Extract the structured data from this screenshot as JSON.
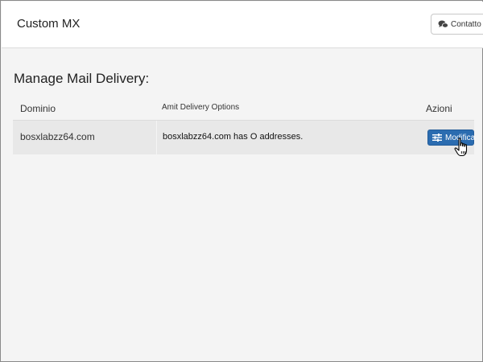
{
  "header": {
    "app_title": "Custom MX",
    "contact_label": "Contatto",
    "contact_icon": "chat-bubbles-icon"
  },
  "main": {
    "page_title": "Manage Mail Delivery:",
    "table": {
      "columns": [
        "Dominio",
        "Amit Delivery Options",
        "Azioni"
      ],
      "rows": [
        {
          "domain": "bosxlabzz64.com",
          "options": "bosxlabzz64.com has O addresses.",
          "action_label": "Modifica",
          "action_icon": "sliders-icon"
        }
      ]
    }
  },
  "colors": {
    "accent": "#2b6cb0",
    "background": "#f4f4f4",
    "row_background": "#e8e8e8"
  },
  "cursor_icon": "hand-pointer-icon"
}
